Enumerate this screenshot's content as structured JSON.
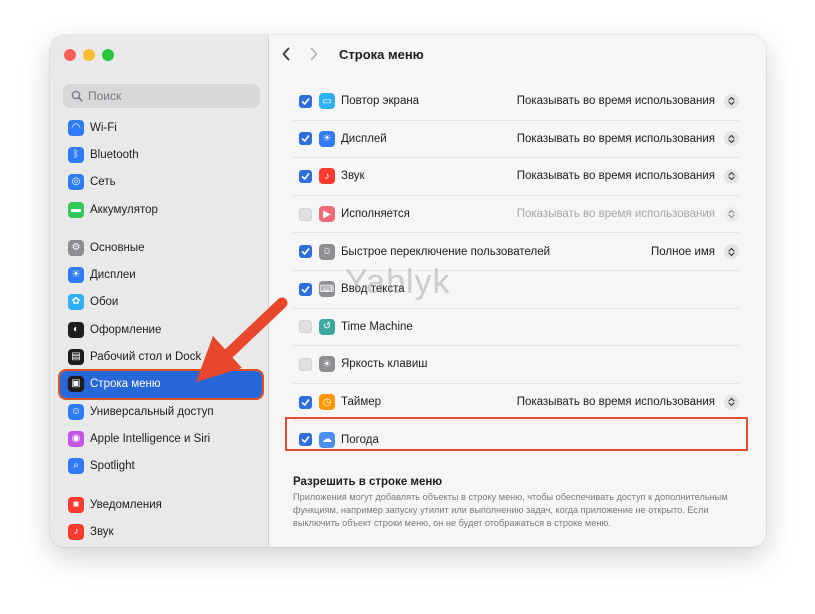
{
  "window": {
    "title": "Строка меню"
  },
  "search": {
    "placeholder": "Поиск"
  },
  "sidebar": {
    "items": [
      {
        "label": "Wi-Fi",
        "icon": "wifi-icon",
        "color": "#2f7cf6"
      },
      {
        "label": "Bluetooth",
        "icon": "bluetooth-icon",
        "color": "#2f7cf6"
      },
      {
        "label": "Сеть",
        "icon": "globe-icon",
        "color": "#2f7cf6"
      },
      {
        "label": "Аккумулятор",
        "icon": "battery-icon",
        "color": "#34c759"
      },
      {
        "label": "Основные",
        "icon": "gear-icon",
        "color": "#8e8e93"
      },
      {
        "label": "Дисплеи",
        "icon": "sun-icon",
        "color": "#2f7cf6"
      },
      {
        "label": "Обои",
        "icon": "flower-icon",
        "color": "#2fb0f6"
      },
      {
        "label": "Оформление",
        "icon": "appearance-icon",
        "color": "#1d1d1f"
      },
      {
        "label": "Рабочий стол и Dock",
        "icon": "dock-icon",
        "color": "#1d1d1f"
      },
      {
        "label": "Строка меню",
        "icon": "menubar-icon",
        "color": "#1d1d1f"
      },
      {
        "label": "Универсальный доступ",
        "icon": "accessibility-icon",
        "color": "#2f7cf6"
      },
      {
        "label": "Apple Intelligence и Siri",
        "icon": "siri-icon",
        "color": "#c455e8"
      },
      {
        "label": "Spotlight",
        "icon": "spotlight-icon",
        "color": "#2f7cf6"
      },
      {
        "label": "Уведомления",
        "icon": "notifications-icon",
        "color": "#ff3b30"
      },
      {
        "label": "Звук",
        "icon": "sound-icon",
        "color": "#ff3b30"
      }
    ]
  },
  "rows": [
    {
      "label": "Повтор экрана",
      "checked": true,
      "icon": "screen-mirroring-icon",
      "color": "#2fb0f6",
      "value": "Показывать во время использования"
    },
    {
      "label": "Дисплей",
      "checked": true,
      "icon": "display-icon",
      "color": "#2f7cf6",
      "value": "Показывать во время использования"
    },
    {
      "label": "Звук",
      "checked": true,
      "icon": "sound-icon",
      "color": "#ff3b30",
      "value": "Показывать во время использования"
    },
    {
      "label": "Исполняется",
      "checked": false,
      "icon": "now-playing-icon",
      "color": "#f06a7a",
      "value": "Показывать во время использования",
      "disabled": true
    },
    {
      "label": "Быстрое переключение пользователей",
      "checked": true,
      "icon": "user-switch-icon",
      "color": "#8e8e93",
      "value": "Полное имя"
    },
    {
      "label": "Ввод текста",
      "checked": true,
      "icon": "keyboard-icon",
      "color": "#8e8e93",
      "value": ""
    },
    {
      "label": "Time Machine",
      "checked": false,
      "icon": "time-machine-icon",
      "color": "#3aa8a0",
      "value": ""
    },
    {
      "label": "Яркость клавиш",
      "checked": false,
      "icon": "keyboard-brightness-icon",
      "color": "#8e8e93",
      "value": ""
    },
    {
      "label": "Таймер",
      "checked": true,
      "icon": "timer-icon",
      "color": "#ff9500",
      "value": "Показывать во время использования"
    },
    {
      "label": "Погода",
      "checked": true,
      "icon": "weather-icon",
      "color": "#4a8ff0",
      "value": ""
    }
  ],
  "allow": {
    "title": "Разрешить в строке меню",
    "description": "Приложения могут добавлять объекты в строку меню, чтобы обеспечивать доступ к дополнительным функциям, например запуску утилит или выполнению задач, когда приложение не открыто. Если выключить объект строки меню, он не будет отображаться в строке меню."
  },
  "watermark": "Yablyk",
  "colors": {
    "accent": "#2f6fd9",
    "highlight": "#e2502a",
    "selection": "#2767d8"
  }
}
